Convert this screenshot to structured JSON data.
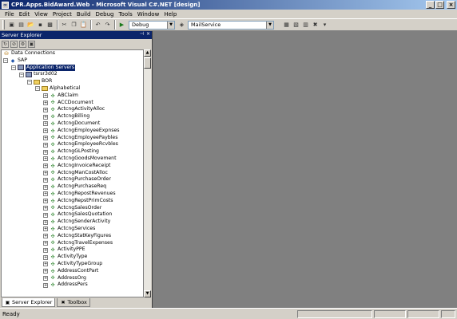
{
  "window": {
    "title": "CPR.Apps.BidAward.Web - Microsoft Visual C#.NET [design]"
  },
  "menu": [
    "File",
    "Edit",
    "View",
    "Project",
    "Build",
    "Debug",
    "Tools",
    "Window",
    "Help"
  ],
  "toolbar": {
    "config_value": "Debug",
    "project_value": "MailService"
  },
  "server_explorer": {
    "title": "Server Explorer",
    "tree": {
      "data_connections": "Data Connections",
      "sap": "SAP",
      "application_servers": "Application Servers",
      "server": "tsrsr3d02",
      "bor": "BOR",
      "alphabetical": "Alphabetical",
      "objects": [
        "ABClaim",
        "ACCDocument",
        "ActcngActivityAlloc",
        "ActcngBilling",
        "ActcngDocument",
        "ActcngEmployeeExpnses",
        "ActcngEmployeePaybles",
        "ActcngEmployeeRcvbles",
        "ActcngGLPosting",
        "ActcngGoodsMovement",
        "ActcngInvoiceReceipt",
        "ActcngManCostAlloc",
        "ActcngPurchaseOrder",
        "ActcngPurchaseReq",
        "ActcngRepostRevenues",
        "ActcngRepstPrimCosts",
        "ActcngSalesOrder",
        "ActcngSalesQuotation",
        "ActcngSenderActivity",
        "ActcngServices",
        "ActcngStatKeyFigures",
        "ActcngTravelExpenses",
        "ActivityPPE",
        "ActivityType",
        "ActivityTypeGroup",
        "AddressContPart",
        "AddressOrg",
        "AddressPers"
      ]
    },
    "tabs": [
      "Server Explorer",
      "Toolbox"
    ]
  },
  "status": {
    "text": "Ready"
  },
  "colors": {
    "titlebar_start": "#0a246a",
    "titlebar_end": "#a6caf0",
    "workspace": "#808080",
    "chrome": "#d4d0c8"
  }
}
